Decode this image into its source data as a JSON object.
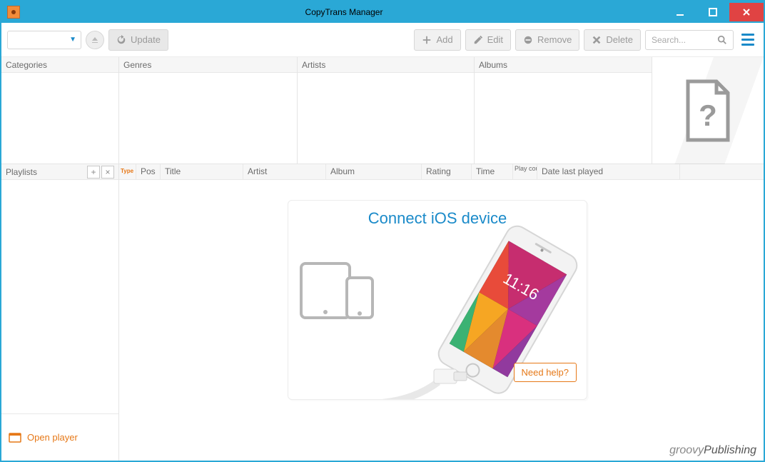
{
  "titlebar": {
    "title": "CopyTrans Manager"
  },
  "toolbar": {
    "update": "Update",
    "add": "Add",
    "edit": "Edit",
    "remove": "Remove",
    "delete": "Delete",
    "search_placeholder": "Search..."
  },
  "panels": {
    "categories": "Categories",
    "genres": "Genres",
    "artists": "Artists",
    "albums": "Albums"
  },
  "playlists": {
    "label": "Playlists"
  },
  "columns": {
    "type": "Type",
    "pos": "Pos",
    "title": "Title",
    "artist": "Artist",
    "album": "Album",
    "rating": "Rating",
    "time": "Time",
    "play_count": "Play\ncount",
    "date_last_played": "Date last played"
  },
  "connect": {
    "title": "Connect iOS device",
    "help": "Need help?"
  },
  "open_player": "Open player",
  "watermark": {
    "a": "groovy",
    "b": "Publishing"
  }
}
